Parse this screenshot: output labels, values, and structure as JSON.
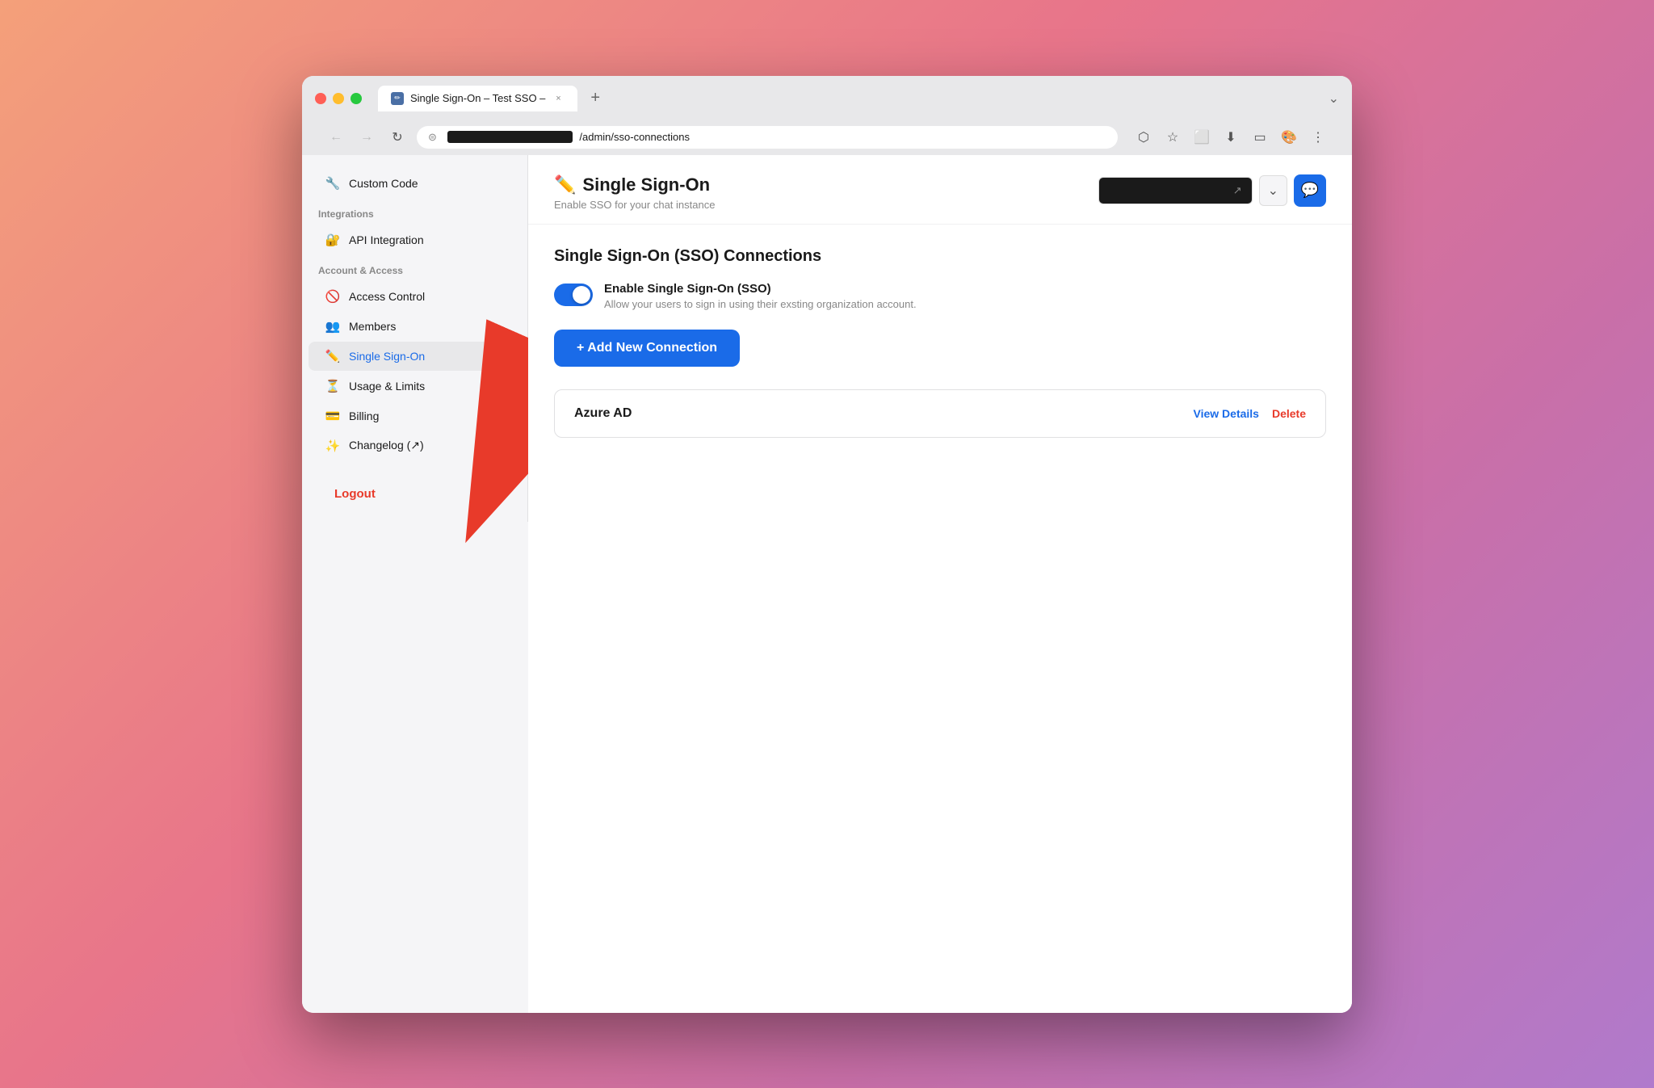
{
  "browser": {
    "tab_title": "Single Sign-On – Test SSO –",
    "tab_close": "×",
    "tab_new": "+",
    "tab_end": "⌄",
    "address": "/admin/sso-connections",
    "address_redacted": "████████████████",
    "favicon_emoji": "✏️"
  },
  "nav": {
    "back_icon": "←",
    "forward_icon": "→",
    "refresh_icon": "↻"
  },
  "sidebar": {
    "custom_code_label": "Custom Code",
    "custom_code_emoji": "🔧",
    "integrations_section": "Integrations",
    "api_integration_label": "API Integration",
    "api_integration_emoji": "🔐",
    "account_section": "Account & Access",
    "access_control_label": "Access Control",
    "access_control_emoji": "🚫",
    "members_label": "Members",
    "members_emoji": "👥",
    "single_sign_on_label": "Single Sign-On",
    "single_sign_on_emoji": "✏️",
    "usage_limits_label": "Usage & Limits",
    "usage_limits_emoji": "⏳",
    "billing_label": "Billing",
    "billing_emoji": "💳",
    "changelog_label": "Changelog (↗)",
    "changelog_emoji": "✨",
    "logout_label": "Logout"
  },
  "page": {
    "title_emoji": "✏️",
    "title": "Single Sign-On",
    "subtitle": "Enable SSO for your chat instance",
    "section_title": "Single Sign-On (SSO) Connections",
    "toggle_label": "Enable Single Sign-On (SSO)",
    "toggle_description": "Allow your users to sign in using their exsting organization account.",
    "add_button_label": "+ Add New Connection",
    "connection_name": "Azure AD",
    "view_details_label": "View Details",
    "delete_label": "Delete"
  },
  "header_actions": {
    "dropdown_icon": "⌄",
    "external_icon": "↗",
    "chat_icon": "💬"
  }
}
